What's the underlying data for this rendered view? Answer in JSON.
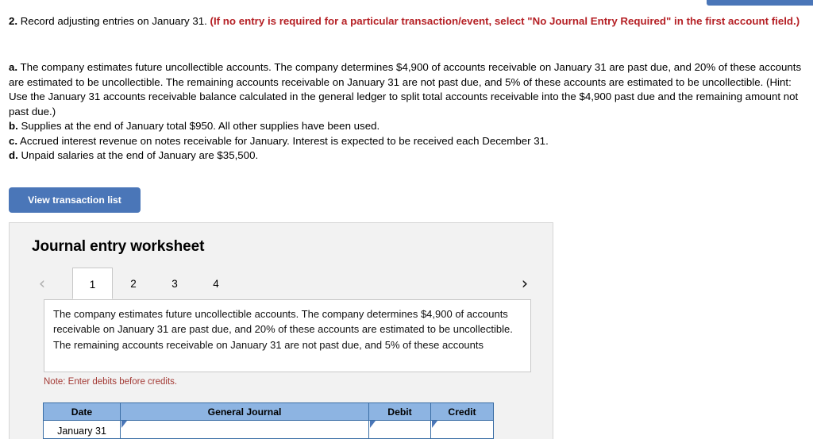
{
  "top_button": {
    "label": ""
  },
  "question": {
    "number": "2.",
    "text": " Record adjusting entries on January 31. ",
    "red_note": "(If no entry is required for a particular transaction/event, select \"No Journal Entry Required\" in the first account field.)"
  },
  "requirements": [
    {
      "label": "a.",
      "text": " The company estimates future uncollectible accounts. The company determines $4,900 of accounts receivable on January 31 are past due, and 20% of these accounts are estimated to be uncollectible. The remaining accounts receivable on January 31 are not past due, and 5% of these accounts are estimated to be uncollectible. (Hint: Use the January 31 accounts receivable balance calculated in the general ledger to split total accounts receivable into the $4,900 past due and the remaining amount not past due.)"
    },
    {
      "label": "b.",
      "text": " Supplies at the end of January total $950. All other supplies have been used."
    },
    {
      "label": "c.",
      "text": " Accrued interest revenue on notes receivable for January. Interest is expected to be received each December 31."
    },
    {
      "label": "d.",
      "text": " Unpaid salaries at the end of January are $35,500."
    }
  ],
  "buttons": {
    "view_transaction_list": "View transaction list"
  },
  "worksheet": {
    "title": "Journal entry worksheet",
    "prev_icon": "chevron-left-icon",
    "next_icon": "chevron-right-icon",
    "prev_glyph": "‹",
    "next_glyph": "›",
    "tabs": [
      {
        "label": "1",
        "active": true
      },
      {
        "label": "2",
        "active": false
      },
      {
        "label": "3",
        "active": false
      },
      {
        "label": "4",
        "active": false
      }
    ],
    "description": "The company estimates future uncollectible accounts. The company determines $4,900 of accounts receivable on January 31 are past due, and 20% of these accounts are estimated to be uncollectible. The remaining accounts receivable on January 31 are not past due, and 5% of these accounts",
    "note": "Note: Enter debits before credits.",
    "table": {
      "headers": [
        "Date",
        "General Journal",
        "Debit",
        "Credit"
      ],
      "rows": [
        {
          "date": "January 31",
          "general_journal": "",
          "debit": "",
          "credit": ""
        }
      ]
    }
  },
  "colors": {
    "accent_blue": "#4a76b8",
    "table_header_blue": "#8db4e2",
    "table_border_blue": "#3a6ea5",
    "red_note": "#b52025",
    "note_red": "#a33a35",
    "panel_bg": "#f2f2f2"
  }
}
